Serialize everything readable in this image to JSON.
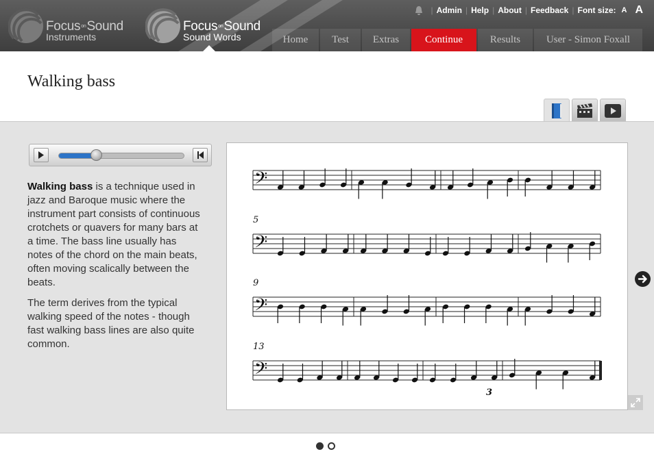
{
  "header": {
    "brands": [
      {
        "name_left": "Focus",
        "name_in": "on",
        "name_right": "Sound",
        "subtitle": "Instruments"
      },
      {
        "name_left": "Focus",
        "name_in": "on",
        "name_right": "Sound",
        "subtitle": "Sound Words"
      }
    ],
    "toplinks": {
      "admin": "Admin",
      "help": "Help",
      "about": "About",
      "feedback": "Feedback",
      "font_size": "Font size:",
      "font_small": "A",
      "font_large": "A"
    },
    "nav": [
      {
        "label": "Home"
      },
      {
        "label": "Test"
      },
      {
        "label": "Extras"
      },
      {
        "label": "Continue"
      },
      {
        "label": "Results"
      },
      {
        "label": "User - Simon Foxall"
      }
    ]
  },
  "page": {
    "title": "Walking bass"
  },
  "view_tabs": {
    "book": "book-icon",
    "clip": "clapperboard-icon",
    "video": "play-icon"
  },
  "player": {
    "progress": 0.3
  },
  "description": {
    "term": "Walking bass",
    "p1_rest": " is a technique used in jazz and Baroque music where the instrument part consists of continuous crotchets or quavers for many bars at a time. The bass line usually has notes of the chord on the main beats, often moving scalically between the beats.",
    "p2": "The term derives from the typical walking speed of the notes - though fast walking bass lines are also quite common."
  },
  "score": {
    "measure_numbers": [
      "5",
      "9",
      "13"
    ],
    "triplet": "3"
  },
  "pager": {
    "pages": 2,
    "current": 1
  }
}
